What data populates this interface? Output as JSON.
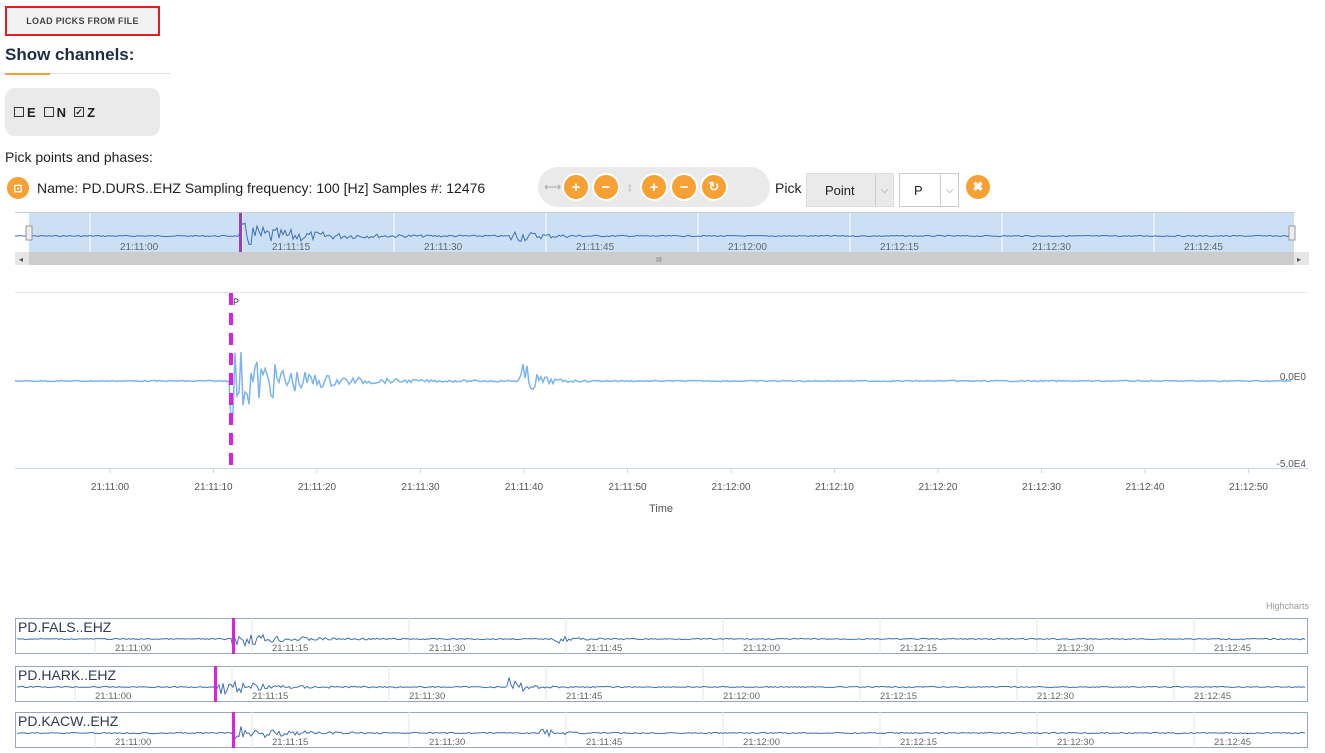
{
  "toolbar": {
    "load_label": "LOAD PICKS FROM FILE"
  },
  "channels": {
    "title": "Show channels:",
    "items": [
      {
        "label": "E",
        "checked": false
      },
      {
        "label": "N",
        "checked": false
      },
      {
        "label": "Z",
        "checked": true
      }
    ]
  },
  "picking": {
    "label": "Pick points and phases:",
    "info": "Name: PD.DURS..EHZ Sampling frequency: 100 [Hz] Samples #: 12476",
    "pick_label": "Pick",
    "mode_value": "Point",
    "phase_value": "P"
  },
  "navigator": {
    "ticks": [
      "21:11:00",
      "21:11:15",
      "21:11:30",
      "21:11:45",
      "21:12:00",
      "21:12:15",
      "21:12:30",
      "21:12:45"
    ]
  },
  "main_chart": {
    "x_ticks": [
      "21:11:00",
      "21:11:10",
      "21:11:20",
      "21:11:30",
      "21:11:40",
      "21:11:50",
      "21:12:00",
      "21:12:10",
      "21:12:20",
      "21:12:30",
      "21:12:40",
      "21:12:50"
    ],
    "y_labels": [
      "0.0E0",
      "-5.0E4"
    ],
    "xlabel": "Time",
    "credit": "Highcharts",
    "pick_marker": "P"
  },
  "stations": [
    {
      "name": "PD.FALS..EHZ",
      "ticks": [
        "21:11:00",
        "21:11:15",
        "21:11:30",
        "21:11:45",
        "21:12:00",
        "21:12:15",
        "21:12:30",
        "21:12:45"
      ]
    },
    {
      "name": "PD.HARK..EHZ",
      "ticks": [
        "21:11:00",
        "21:11:15",
        "21:11:30",
        "21:11:45",
        "21:12:00",
        "21:12:15",
        "21:12:30",
        "21:12:45"
      ]
    },
    {
      "name": "PD.KACW..EHZ",
      "ticks": [
        "21:11:00",
        "21:11:15",
        "21:11:30",
        "21:11:45",
        "21:12:00",
        "21:12:15",
        "21:12:30",
        "21:12:45"
      ]
    }
  ],
  "colors": {
    "accent": "#f7a033",
    "signal": "#7cb5ec",
    "pick": "#e020e0",
    "navigator_fill": "#cce0f5"
  }
}
